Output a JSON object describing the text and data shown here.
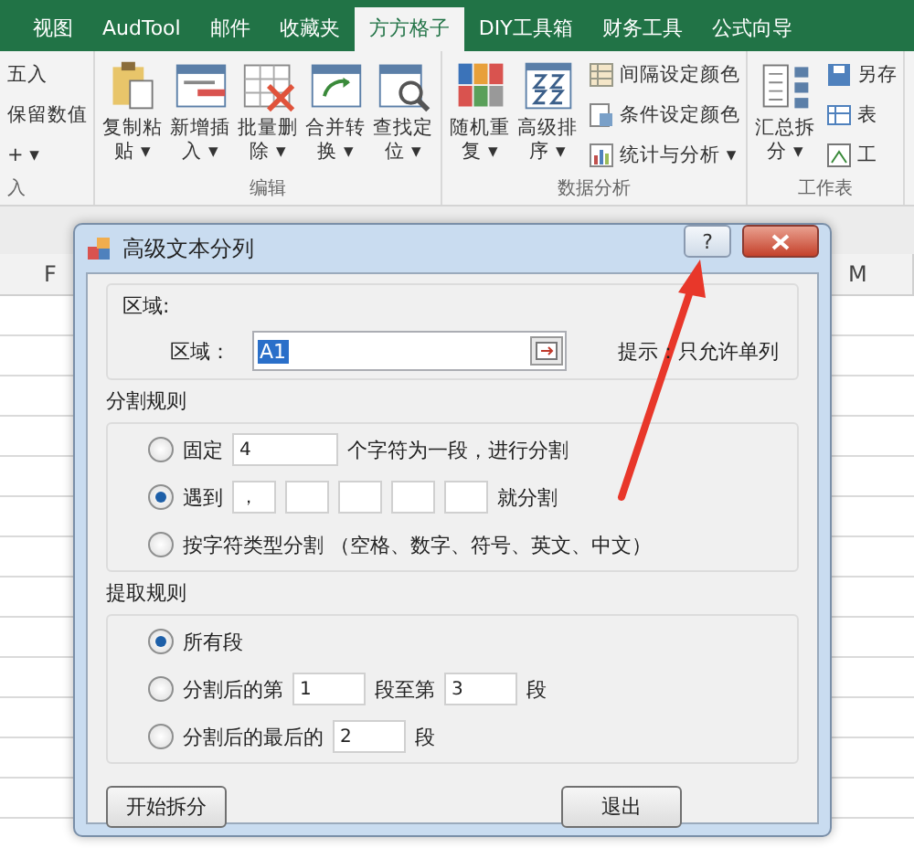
{
  "ribbon": {
    "tabs": [
      {
        "label": "视图",
        "selected": false
      },
      {
        "label": "AudTool",
        "selected": false
      },
      {
        "label": "邮件",
        "selected": false
      },
      {
        "label": "收藏夹",
        "selected": false
      },
      {
        "label": "方方格子",
        "selected": true
      },
      {
        "label": "DIY工具箱",
        "selected": false
      },
      {
        "label": "财务工具",
        "selected": false
      },
      {
        "label": "公式向导",
        "selected": false
      }
    ],
    "groups": [
      {
        "label": "入",
        "small": [
          "五入",
          "保留数值",
          "+ ▾"
        ]
      },
      {
        "label": "编辑",
        "large": [
          {
            "label_lines": [
              "复制粘",
              "贴 ▾"
            ]
          },
          {
            "label_lines": [
              "新增插",
              "入 ▾"
            ]
          },
          {
            "label_lines": [
              "批量删",
              "除 ▾"
            ]
          },
          {
            "label_lines": [
              "合并转",
              "换 ▾"
            ]
          },
          {
            "label_lines": [
              "查找定",
              "位 ▾"
            ]
          }
        ]
      },
      {
        "label": "数据分析",
        "large": [
          {
            "label_lines": [
              "随机重",
              "复 ▾"
            ]
          },
          {
            "label_lines": [
              "高级排",
              "序 ▾"
            ]
          }
        ],
        "small": [
          "间隔设定颜色",
          "条件设定颜色",
          "统计与分析 ▾"
        ]
      },
      {
        "label": "工作表",
        "large": [
          {
            "label_lines": [
              "汇总拆",
              "分 ▾"
            ]
          }
        ],
        "small": [
          "另存",
          "表",
          "工"
        ]
      }
    ]
  },
  "sheet": {
    "column_headers": [
      "F",
      "M"
    ]
  },
  "dialog": {
    "title": "高级文本分列",
    "help_button": "?",
    "region": {
      "legend": "区域:",
      "label": "区域：",
      "value": "A1",
      "value_highlighted": true,
      "hint": "提示：只允许单列"
    },
    "split_rules": {
      "legend": "分割规则",
      "options": [
        {
          "kind": "fixed",
          "selected": false,
          "label": "固定",
          "value": "4",
          "suffix": "个字符为一段，进行分割"
        },
        {
          "kind": "delimiters",
          "selected": true,
          "label": "遇到",
          "fields": [
            {
              "kind": "text_field",
              "value": "，"
            },
            {
              "kind": "text_field"
            },
            {
              "kind": "text_field"
            },
            {
              "kind": "text_field"
            },
            {
              "kind": "text_field"
            }
          ],
          "suffix": "就分割"
        },
        {
          "kind": "by_type",
          "selected": false,
          "label": "按字符类型分割 （空格、数字、符号、英文、中文）"
        }
      ]
    },
    "extract_rules": {
      "legend": "提取规则",
      "options": [
        {
          "kind": "all",
          "selected": true,
          "label": "所有段"
        },
        {
          "kind": "range",
          "selected": false,
          "label": "分割后的第",
          "from": "1",
          "middle": "段至第",
          "to": "3",
          "suffix": "段"
        },
        {
          "kind": "last",
          "selected": false,
          "label": "分割后的最后的",
          "value": "2",
          "suffix": "段"
        }
      ]
    },
    "buttons": [
      "开始拆分",
      "退出"
    ]
  }
}
